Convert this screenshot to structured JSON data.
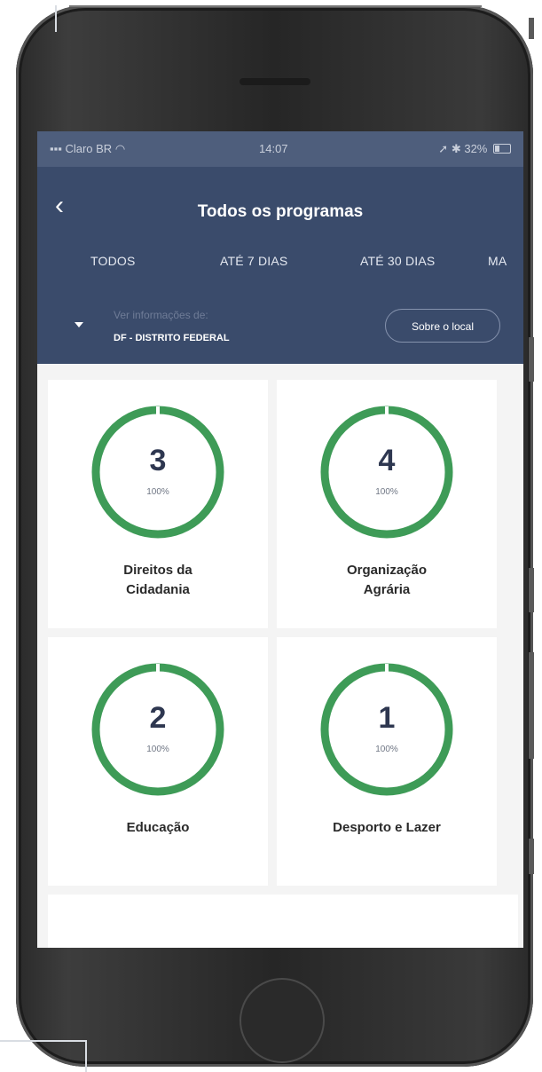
{
  "status_bar": {
    "carrier": "Claro BR",
    "time": "14:07",
    "battery": "32%"
  },
  "header": {
    "title": "Todos os programas"
  },
  "tabs": [
    {
      "label": "TODOS"
    },
    {
      "label": "ATÉ 7 DIAS"
    },
    {
      "label": "ATÉ 30 DIAS"
    },
    {
      "label": "MA"
    }
  ],
  "location": {
    "caption": "Ver informações de:",
    "value": "DF - DISTRITO FEDERAL",
    "about_label": "Sobre o local"
  },
  "programs": [
    {
      "count": "3",
      "percent": "100%",
      "label_line1": "Direitos da",
      "label_line2": "Cidadania",
      "progress": 1.0
    },
    {
      "count": "4",
      "percent": "100%",
      "label_line1": "Organização",
      "label_line2": "Agrária",
      "progress": 1.0
    },
    {
      "count": "2",
      "percent": "100%",
      "label_line1": "Educação",
      "label_line2": "",
      "progress": 1.0
    },
    {
      "count": "1",
      "percent": "100%",
      "label_line1": "Desporto e Lazer",
      "label_line2": "",
      "progress": 1.0
    }
  ],
  "colors": {
    "header": "#3a4b6b",
    "ring": "#3e9b57",
    "ring_gap": "#ffffff"
  }
}
